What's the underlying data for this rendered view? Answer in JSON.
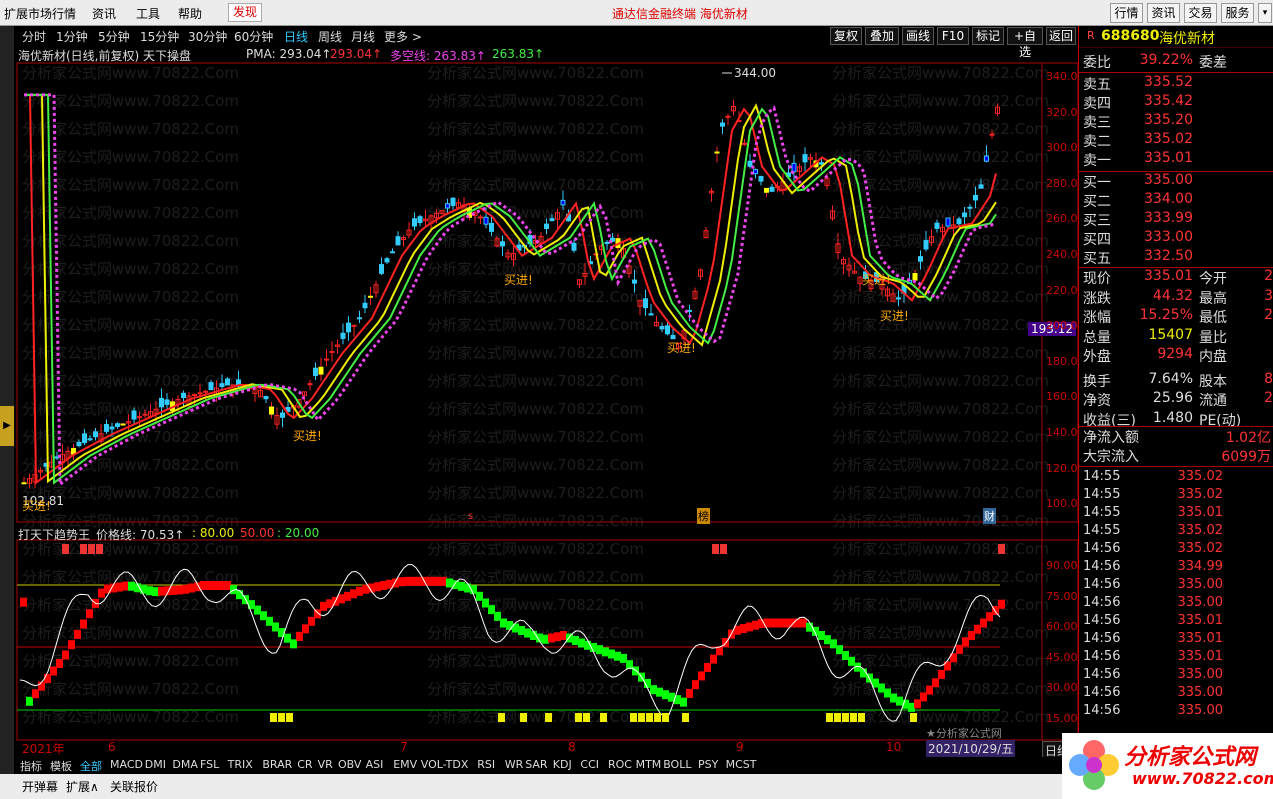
{
  "menu": {
    "items": [
      "扩展市场行情",
      "资讯",
      "工具",
      "帮助"
    ],
    "discover": "发现",
    "center_title": "通达信金融终端   海优新材",
    "right_buttons": [
      "行情",
      "资讯",
      "交易",
      "服务"
    ]
  },
  "periods": [
    "分时",
    "1分钟",
    "5分钟",
    "15分钟",
    "30分钟",
    "60分钟",
    "日线",
    "周线",
    "月线",
    "更多 >"
  ],
  "period_active": "日线",
  "toolbar": [
    "复权",
    "叠加",
    "画线",
    "F10",
    "标记",
    "+自选",
    "返回"
  ],
  "main_chart": {
    "title": "海优新材(日线,前复权) 天下操盘",
    "pma_label": "PMA: 293.04↑",
    "pma_val2": "293.04↑",
    "duokong_label": "多空线: 263.83↑",
    "duokong_val2": "263.83↑",
    "peak_label": "344.00",
    "low_label": "102.81",
    "buy_signal": "买进!",
    "marker_s": "s",
    "marker_bang": "榜",
    "marker_cai": "财",
    "cursor_price": "193.12",
    "y_ticks": [
      "340.0",
      "320.0",
      "300.0",
      "280.0",
      "260.0",
      "240.0",
      "220.0",
      "200.0",
      "180.0",
      "160.0",
      "140.0",
      "120.0",
      "100.0"
    ]
  },
  "indicator": {
    "title": "打天下趋势王",
    "price_line": "价格线: 70.53↑",
    "l80": ": 80.00",
    "l50": "50.00",
    "l20": ": 20.00",
    "y_ticks": [
      "90.00",
      "75.00",
      "60.00",
      "45.00",
      "30.00",
      "15.00"
    ]
  },
  "xaxis": {
    "labels": [
      "2021年",
      "6",
      "7",
      "8",
      "9",
      "10"
    ],
    "period_btn": "日线",
    "date": "2021/10/29/五",
    "watermark": "★分析家公式网"
  },
  "tabs": [
    "指标",
    "模板",
    "全部",
    "MACD",
    "DMI",
    "DMA",
    "FSL",
    "TRIX",
    "BRAR",
    "CR",
    "VR",
    "OBV",
    "ASI",
    "EMV",
    "VOL-TDX",
    "RSI",
    "WR",
    "SAR",
    "KDJ",
    "CCI",
    "ROC",
    "MTM",
    "BOLL",
    "PSY",
    "MCST"
  ],
  "tabs_active": "全部",
  "status": [
    "开弹幕",
    "扩展∧",
    "关联报价"
  ],
  "quote": {
    "code": "688680",
    "name": "海优新材",
    "weibi_label": "委比",
    "weibi": "39.22%",
    "weicha_label": "委差",
    "sells": [
      [
        "卖五",
        "335.52"
      ],
      [
        "卖四",
        "335.42"
      ],
      [
        "卖三",
        "335.20"
      ],
      [
        "卖二",
        "335.02"
      ],
      [
        "卖一",
        "335.01"
      ]
    ],
    "buys": [
      [
        "买一",
        "335.00"
      ],
      [
        "买二",
        "334.00"
      ],
      [
        "买三",
        "333.99"
      ],
      [
        "买四",
        "333.00"
      ],
      [
        "买五",
        "332.50"
      ]
    ],
    "stats": [
      [
        "现价",
        "335.01",
        "今开",
        "2"
      ],
      [
        "涨跌",
        "44.32",
        "最高",
        "3"
      ],
      [
        "涨幅",
        "15.25%",
        "最低",
        "2"
      ],
      [
        "总量",
        "15407",
        "量比",
        ""
      ],
      [
        "外盘",
        "9294",
        "内盘",
        ""
      ],
      [
        "换手",
        "7.64%",
        "股本",
        "8"
      ],
      [
        "净资",
        "25.96",
        "流通",
        "2"
      ],
      [
        "收益(三)",
        "1.480",
        "PE(动)",
        ""
      ]
    ],
    "flow": [
      [
        "净流入额",
        "1.02亿"
      ],
      [
        "大宗流入",
        "6099万"
      ]
    ],
    "ticks": [
      [
        "14:55",
        "335.02"
      ],
      [
        "14:55",
        "335.02"
      ],
      [
        "14:55",
        "335.01"
      ],
      [
        "14:55",
        "335.02"
      ],
      [
        "14:56",
        "335.02"
      ],
      [
        "14:56",
        "334.99"
      ],
      [
        "14:56",
        "335.00"
      ],
      [
        "14:56",
        "335.00"
      ],
      [
        "14:56",
        "335.01"
      ],
      [
        "14:56",
        "335.01"
      ],
      [
        "14:56",
        "335.01"
      ],
      [
        "14:56",
        "335.00"
      ],
      [
        "14:56",
        "335.00"
      ],
      [
        "14:56",
        "335.00"
      ]
    ]
  },
  "logo": {
    "name": "分析家公式网",
    "url": "www.70822.com"
  },
  "watermark_text": "分析家公式网www.70822.Com"
}
